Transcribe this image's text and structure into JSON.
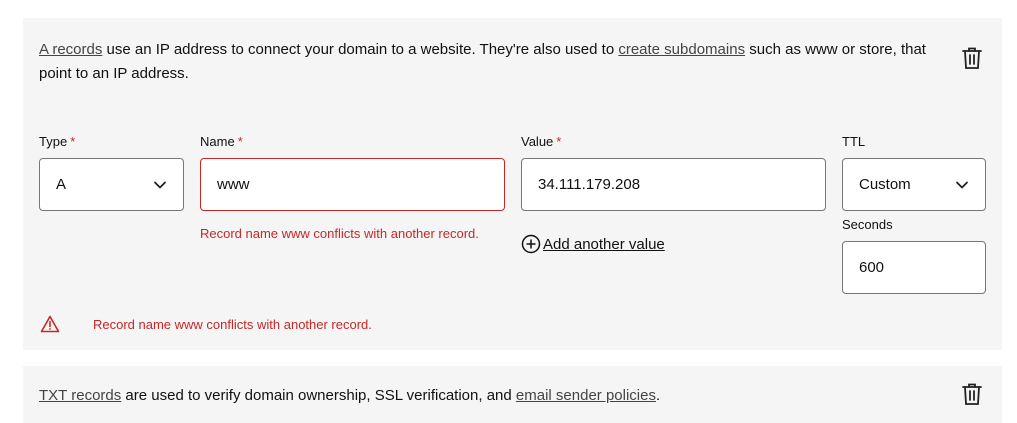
{
  "a_record": {
    "desc_link1": "A records",
    "desc_text1": " use an IP address to connect your domain to a website. They're also used to ",
    "desc_link2": "create subdomains",
    "desc_text2": " such as www or store, that point to an IP address.",
    "type_label": "Type",
    "name_label": "Name",
    "value_label": "Value",
    "ttl_label": "TTL",
    "required_mark": "*",
    "type_value": "A",
    "name_value": "www",
    "value_value": "34.111.179.208",
    "ttl_value": "Custom",
    "name_error": "Record name www conflicts with another record.",
    "add_value_label": "Add another value",
    "seconds_label": "Seconds",
    "seconds_value": "600",
    "form_error": "Record name www conflicts with another record."
  },
  "txt_record": {
    "desc_link1": "TXT records",
    "desc_text1": " are used to verify domain ownership, SSL verification, and ",
    "desc_link2": "email sender policies",
    "desc_text2": "."
  },
  "colors": {
    "error": "#c62828",
    "panel": "#f5f5f5",
    "border": "#777777"
  },
  "icons": [
    "trash-icon",
    "chevron-down-icon",
    "plus-circle-icon",
    "warning-triangle-icon"
  ]
}
